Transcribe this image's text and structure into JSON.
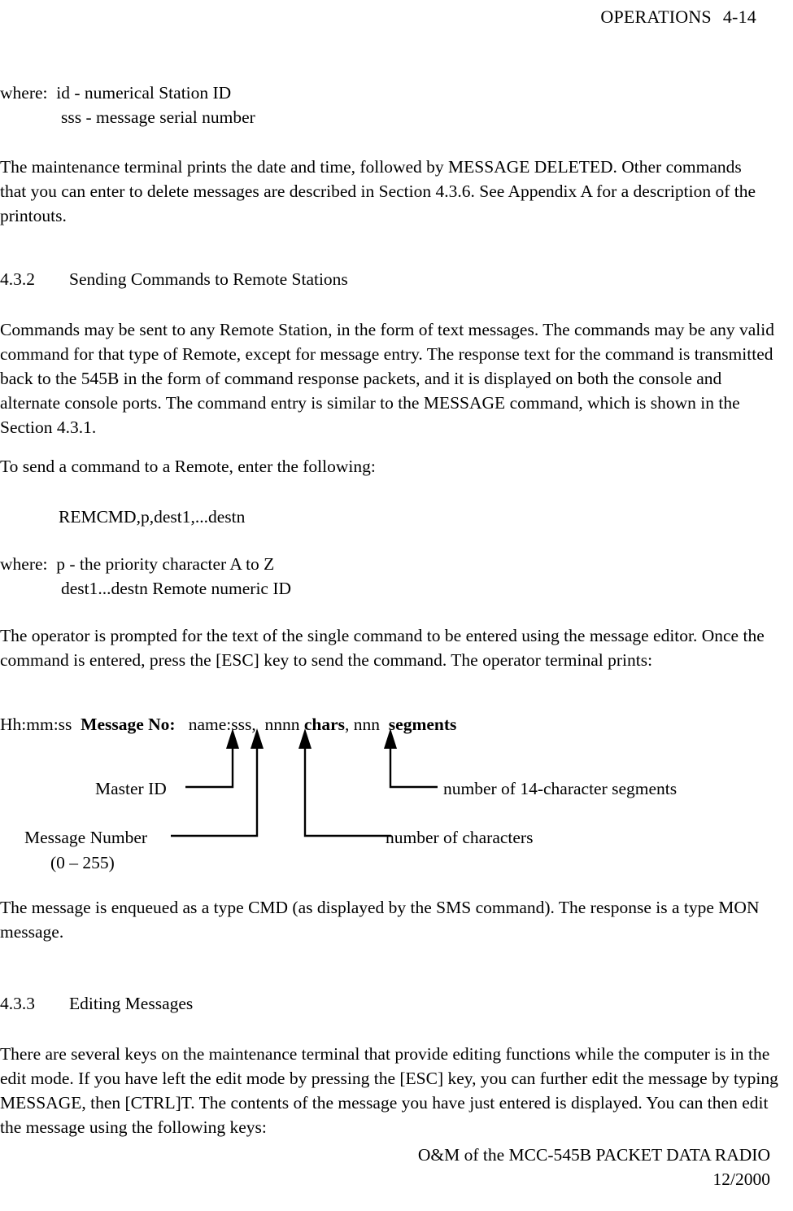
{
  "header": {
    "section": "OPERATIONS",
    "page_number": "4-14"
  },
  "body": {
    "where_block_1": {
      "label": "where:",
      "line1": "id  - numerical Station ID",
      "line2": "sss - message serial number"
    },
    "paragraph_1": "The maintenance terminal prints the date and time, followed by MESSAGE DELETED. Other commands that you can enter to delete messages are described in Section 4.3.6. See Appendix A for a description of the printouts.",
    "heading_432": {
      "number": "4.3.2",
      "title": "Sending Commands to Remote Stations"
    },
    "paragraph_2": "Commands may be sent to any Remote Station, in the form of text messages. The commands may be any valid command for that type of Remote, except for message entry. The response text for the command is transmitted back to the 545B in the form of command response packets, and it is displayed on both the console and alternate console ports. The command entry is similar to the MESSAGE command, which is shown in the Section 4.3.1.",
    "paragraph_3": "To send a command to a Remote, enter the following:",
    "command_syntax": "REMCMD,p,dest1,...destn",
    "where_block_2": {
      "label": "where:",
      "line1": "p - the priority character A to Z",
      "line2": "dest1...destn  Remote numeric ID"
    },
    "paragraph_4": "The operator is prompted for the text of the single command to be entered using the message editor. Once the command is entered, press the [ESC] key to send the command. The operator terminal prints:",
    "print_example": {
      "time": "Hh:mm:ss",
      "message_no_label": "Message No:",
      "name_sss": "name:sss,",
      "nnnn": "nnnn",
      "chars": "chars",
      "nnn": ", nnn",
      "segments": "segments"
    },
    "paragraph_5": "The message is enqueued as a type CMD (as displayed by the SMS command). The response is a type MON message.",
    "heading_433": {
      "number": "4.3.3",
      "title": "Editing Messages"
    },
    "paragraph_6": "There are several keys on the maintenance terminal that provide editing functions while the computer is in the edit mode. If you have left the edit mode by pressing the [ESC] key, you can further  edit the message by typing MESSAGE, then [CTRL]T.  The contents of the message you have just entered is displayed. You can then edit the message using the following keys:"
  },
  "diagram": {
    "labels": {
      "master_id": "Master ID",
      "message_number": "Message Number",
      "message_number_range": "(0 – 255)",
      "number_of_characters": "number of characters",
      "number_of_segments": "number of 14-character segments"
    },
    "line_color": "#000000"
  },
  "footer": {
    "line1": "O&M of the MCC-545B PACKET DATA RADIO",
    "line2": "12/2000"
  }
}
